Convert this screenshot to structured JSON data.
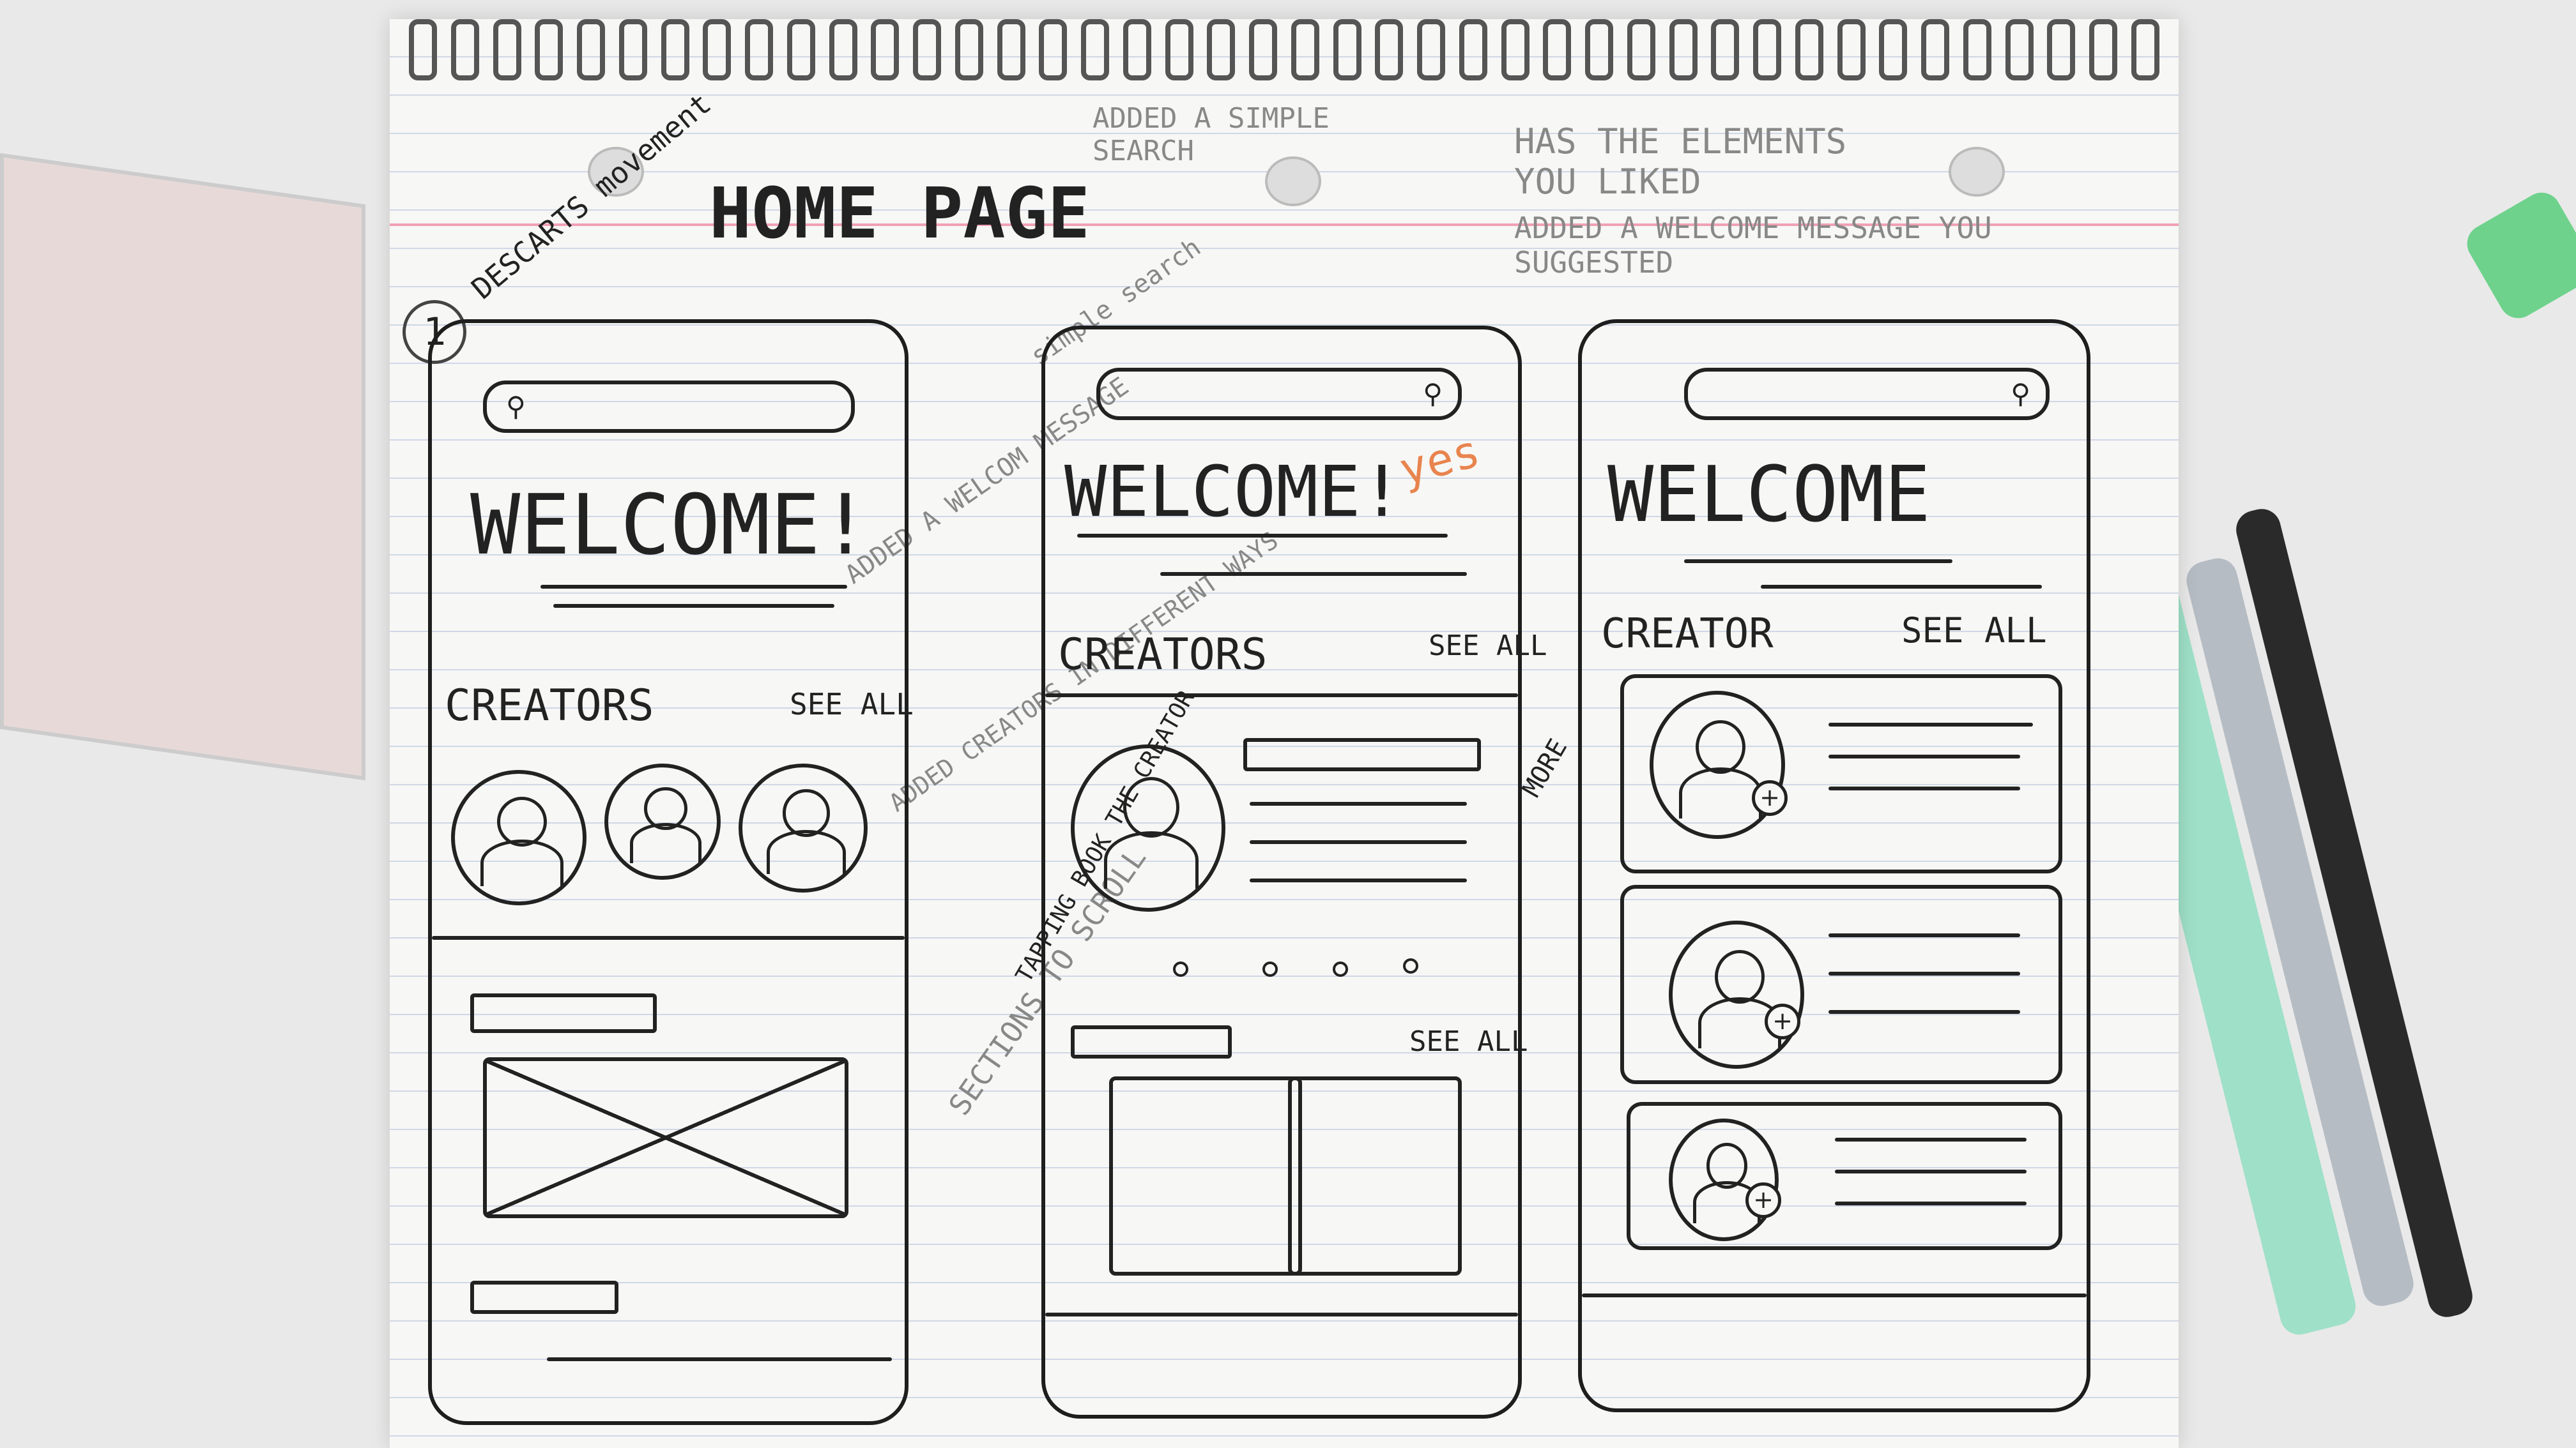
{
  "title": "HOME PAGE",
  "side_note": "DESCARTS movement",
  "circle_number": "1",
  "top_notes": {
    "note_a": "ADDED A SIMPLE SEARCH",
    "note_1": "HAS THE ELEMENTS YOU LIKED",
    "note_2": "ADDED A WELCOME MESSAGE YOU SUGGESTED"
  },
  "margin_notes": {
    "simple_search": "simple search",
    "welcome_msg": "ADDED A WELCOM MESSAGE",
    "creators_ways": "ADDED CREATORS IN DIFFERENT WAYS",
    "tapping": "TAPPING BOOK THE CREATOR",
    "sections": "SECTIONS TO SCROLL",
    "yes": "yes",
    "more": "MORE"
  },
  "sketches": [
    {
      "welcome": "WELCOME!",
      "section": "CREATORS",
      "see_all": "SEE ALL"
    },
    {
      "welcome": "WELCOME!",
      "section": "CREATORS",
      "see_all": "SEE ALL",
      "see_all_2": "SEE ALL"
    },
    {
      "welcome": "WELCOME",
      "section": "CREATOR",
      "see_all": "SEE ALL"
    }
  ],
  "icons": [
    "search-icon",
    "avatar-icon",
    "plus-icon",
    "image-placeholder-icon"
  ]
}
